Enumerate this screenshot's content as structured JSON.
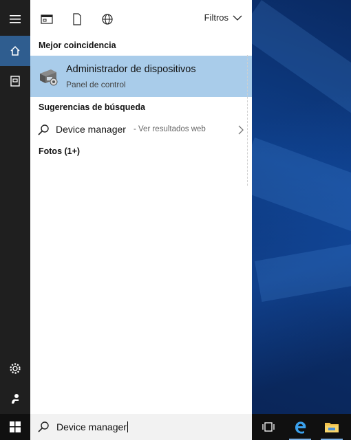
{
  "top_tabs": {
    "apps_icon": "apps-grid-icon",
    "documents_icon": "document-icon",
    "web_icon": "globe-icon",
    "filters_label": "Filtros"
  },
  "sections": {
    "best_match": "Mejor coincidencia",
    "suggestions": "Sugerencias de búsqueda",
    "photos": "Fotos (1+)"
  },
  "best_result": {
    "title": "Administrador de dispositivos",
    "subtitle": "Panel de control",
    "icon": "device-manager-icon"
  },
  "suggestion": {
    "query": "Device manager",
    "hint": "- Ver resultados web"
  },
  "search": {
    "value": "Device manager"
  },
  "rail": [
    "hamburger-icon",
    "home-icon",
    "notebook-icon",
    "settings-icon",
    "feedback-icon"
  ],
  "taskbar": [
    "start-icon",
    "task-view-icon",
    "edge-icon",
    "file-explorer-icon"
  ],
  "colors": {
    "accent": "#2f5d8f",
    "selection": "#a9ccea",
    "rail": "#1f1f1f",
    "taskbar": "#101010"
  }
}
